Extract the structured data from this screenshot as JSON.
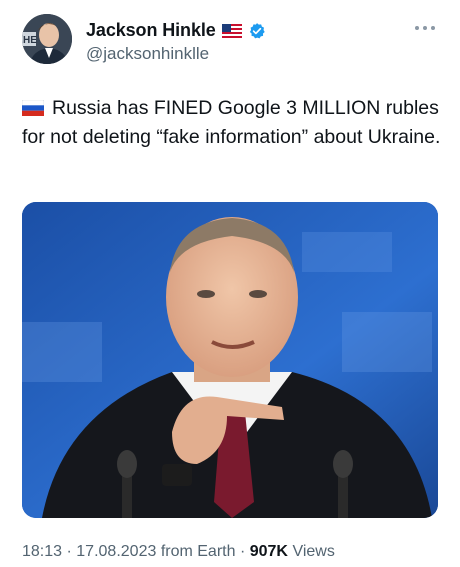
{
  "author": {
    "display_name": "Jackson Hinkle",
    "handle": "@jacksonhinklle",
    "avatar_icon": "avatar-photo",
    "country_flag_icon": "us-flag-icon",
    "verified_icon": "verified-badge-icon",
    "verified_color": "#1d9bf0",
    "avatar_overlay_text": "HE"
  },
  "tweet": {
    "flag_icon": "russia-flag-icon",
    "text": "Russia has FINED Google 3 MILLION rubles for not deleting “fake information” about Ukraine.",
    "media_icon": "photo-of-speaker-pointing"
  },
  "meta": {
    "time": "18:13",
    "separator": "·",
    "date": "17.08.2023",
    "source": "from Earth",
    "views_count": "907K",
    "views_label": "Views"
  },
  "colors": {
    "text_primary": "#0f1419",
    "text_secondary": "#536471",
    "accent": "#1d9bf0"
  }
}
